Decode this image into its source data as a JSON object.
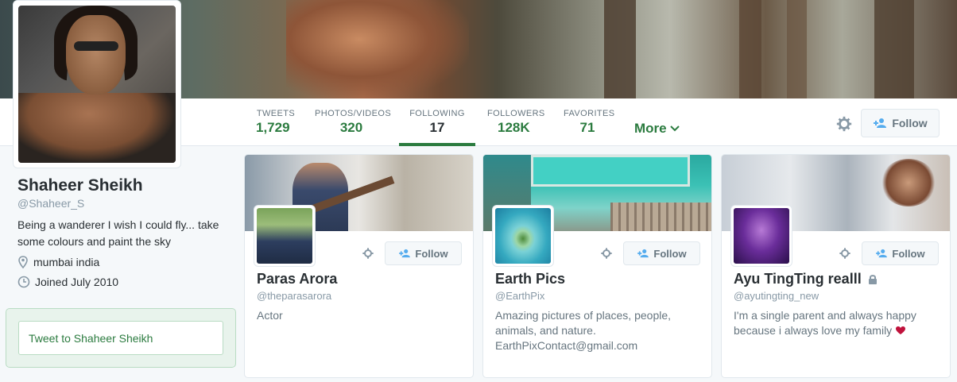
{
  "profile": {
    "name": "Shaheer Sheikh",
    "handle": "@Shaheer_S",
    "bio": "Being a wanderer I wish I could fly... take some colours and paint the sky",
    "location": "mumbai india",
    "joined": "Joined July 2010",
    "tweet_to": "Tweet to Shaheer Sheikh"
  },
  "nav": {
    "stats": [
      {
        "label": "TWEETS",
        "value": "1,729"
      },
      {
        "label": "PHOTOS/VIDEOS",
        "value": "320"
      },
      {
        "label": "FOLLOWING",
        "value": "17"
      },
      {
        "label": "FOLLOWERS",
        "value": "128K"
      },
      {
        "label": "FAVORITES",
        "value": "71"
      }
    ],
    "active_stat": "FOLLOWING",
    "more_label": "More",
    "follow_label": "Follow"
  },
  "cards": [
    {
      "name": "Paras Arora",
      "handle": "@theparasarora",
      "bio": "Actor",
      "follow_label": "Follow",
      "protected": false
    },
    {
      "name": "Earth Pics",
      "handle": "@EarthPix",
      "bio": "Amazing pictures of places, people, animals, and nature. EarthPixContact@gmail.com",
      "follow_label": "Follow",
      "protected": false
    },
    {
      "name": "Ayu TingTing realll",
      "handle": "@ayutingting_new",
      "bio": "I'm a single parent and always happy because i always love my family",
      "follow_label": "Follow",
      "protected": true
    }
  ],
  "colors": {
    "accent": "#2b7b3f",
    "text": "#292f33",
    "muted": "#8899a6"
  }
}
